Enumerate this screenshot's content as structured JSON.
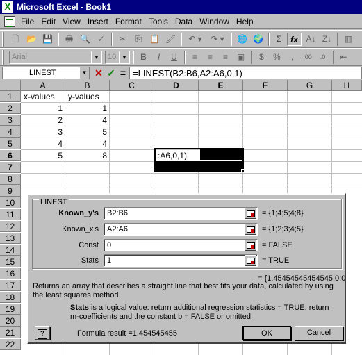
{
  "window": {
    "title": "Microsoft Excel - Book1"
  },
  "menu": [
    "File",
    "Edit",
    "View",
    "Insert",
    "Format",
    "Tools",
    "Data",
    "Window",
    "Help"
  ],
  "formatting": {
    "font": "Arial",
    "size": "10"
  },
  "formula_bar": {
    "name_box": "LINEST",
    "cancel_label": "✕",
    "enter_label": "✓",
    "equals_label": "=",
    "formula": "=LINEST(B2:B6,A2:A6,0,1)"
  },
  "columns": [
    "A",
    "B",
    "C",
    "D",
    "E",
    "F",
    "G",
    "H"
  ],
  "rows": [
    "1",
    "2",
    "3",
    "4",
    "5",
    "6",
    "7",
    "8",
    "9",
    "10",
    "11",
    "12",
    "13",
    "14",
    "15",
    "16",
    "17",
    "18",
    "19",
    "20",
    "21",
    "22"
  ],
  "cells": {
    "A1": "x-values",
    "B1": "y-values",
    "A2": "1",
    "B2": "1",
    "A3": "2",
    "B3": "4",
    "A4": "3",
    "B4": "5",
    "A5": "4",
    "B5": "4",
    "A6": "5",
    "B6": "8",
    "D6": ":A6,0,1)"
  },
  "dialog": {
    "title": "LINEST",
    "args": [
      {
        "label": "Known_y's",
        "value": "B2:B6",
        "result": "= {1;4;5;4;8}"
      },
      {
        "label": "Known_x's",
        "value": "A2:A6",
        "result": "= {1;2;3;4;5}"
      },
      {
        "label": "Const",
        "value": "0",
        "result": "= FALSE"
      },
      {
        "label": "Stats",
        "value": "1",
        "result": "= TRUE"
      }
    ],
    "overall_result": "= {1.45454545454545,0;0",
    "description": "Returns an array that describes a straight line that best fits your data, calculated by using the least squares method.",
    "arg_help_name": "Stats",
    "arg_help_text": " is a logical value: return additional regression statistics = TRUE; return m-coefficients and the constant b = FALSE or omitted.",
    "formula_result": "Formula result =1.454545455",
    "ok": "OK",
    "cancel": "Cancel",
    "help": "?"
  }
}
